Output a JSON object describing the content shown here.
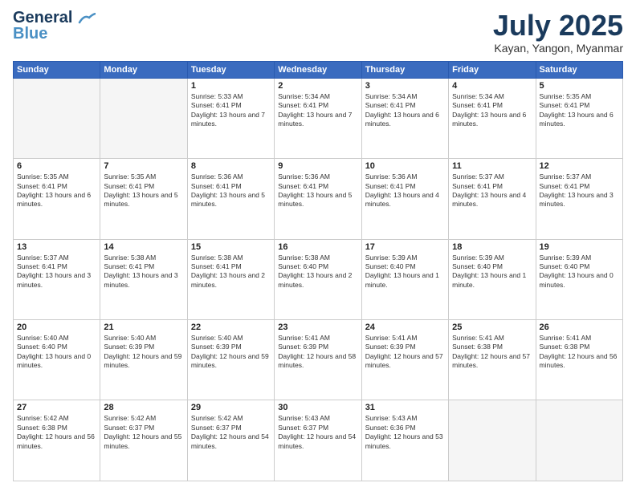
{
  "logo": {
    "line1": "General",
    "line2": "Blue"
  },
  "header": {
    "month": "July 2025",
    "location": "Kayan, Yangon, Myanmar"
  },
  "weekdays": [
    "Sunday",
    "Monday",
    "Tuesday",
    "Wednesday",
    "Thursday",
    "Friday",
    "Saturday"
  ],
  "weeks": [
    [
      {
        "day": "",
        "info": ""
      },
      {
        "day": "",
        "info": ""
      },
      {
        "day": "1",
        "info": "Sunrise: 5:33 AM\nSunset: 6:41 PM\nDaylight: 13 hours and 7 minutes."
      },
      {
        "day": "2",
        "info": "Sunrise: 5:34 AM\nSunset: 6:41 PM\nDaylight: 13 hours and 7 minutes."
      },
      {
        "day": "3",
        "info": "Sunrise: 5:34 AM\nSunset: 6:41 PM\nDaylight: 13 hours and 6 minutes."
      },
      {
        "day": "4",
        "info": "Sunrise: 5:34 AM\nSunset: 6:41 PM\nDaylight: 13 hours and 6 minutes."
      },
      {
        "day": "5",
        "info": "Sunrise: 5:35 AM\nSunset: 6:41 PM\nDaylight: 13 hours and 6 minutes."
      }
    ],
    [
      {
        "day": "6",
        "info": "Sunrise: 5:35 AM\nSunset: 6:41 PM\nDaylight: 13 hours and 6 minutes."
      },
      {
        "day": "7",
        "info": "Sunrise: 5:35 AM\nSunset: 6:41 PM\nDaylight: 13 hours and 5 minutes."
      },
      {
        "day": "8",
        "info": "Sunrise: 5:36 AM\nSunset: 6:41 PM\nDaylight: 13 hours and 5 minutes."
      },
      {
        "day": "9",
        "info": "Sunrise: 5:36 AM\nSunset: 6:41 PM\nDaylight: 13 hours and 5 minutes."
      },
      {
        "day": "10",
        "info": "Sunrise: 5:36 AM\nSunset: 6:41 PM\nDaylight: 13 hours and 4 minutes."
      },
      {
        "day": "11",
        "info": "Sunrise: 5:37 AM\nSunset: 6:41 PM\nDaylight: 13 hours and 4 minutes."
      },
      {
        "day": "12",
        "info": "Sunrise: 5:37 AM\nSunset: 6:41 PM\nDaylight: 13 hours and 3 minutes."
      }
    ],
    [
      {
        "day": "13",
        "info": "Sunrise: 5:37 AM\nSunset: 6:41 PM\nDaylight: 13 hours and 3 minutes."
      },
      {
        "day": "14",
        "info": "Sunrise: 5:38 AM\nSunset: 6:41 PM\nDaylight: 13 hours and 3 minutes."
      },
      {
        "day": "15",
        "info": "Sunrise: 5:38 AM\nSunset: 6:41 PM\nDaylight: 13 hours and 2 minutes."
      },
      {
        "day": "16",
        "info": "Sunrise: 5:38 AM\nSunset: 6:40 PM\nDaylight: 13 hours and 2 minutes."
      },
      {
        "day": "17",
        "info": "Sunrise: 5:39 AM\nSunset: 6:40 PM\nDaylight: 13 hours and 1 minute."
      },
      {
        "day": "18",
        "info": "Sunrise: 5:39 AM\nSunset: 6:40 PM\nDaylight: 13 hours and 1 minute."
      },
      {
        "day": "19",
        "info": "Sunrise: 5:39 AM\nSunset: 6:40 PM\nDaylight: 13 hours and 0 minutes."
      }
    ],
    [
      {
        "day": "20",
        "info": "Sunrise: 5:40 AM\nSunset: 6:40 PM\nDaylight: 13 hours and 0 minutes."
      },
      {
        "day": "21",
        "info": "Sunrise: 5:40 AM\nSunset: 6:39 PM\nDaylight: 12 hours and 59 minutes."
      },
      {
        "day": "22",
        "info": "Sunrise: 5:40 AM\nSunset: 6:39 PM\nDaylight: 12 hours and 59 minutes."
      },
      {
        "day": "23",
        "info": "Sunrise: 5:41 AM\nSunset: 6:39 PM\nDaylight: 12 hours and 58 minutes."
      },
      {
        "day": "24",
        "info": "Sunrise: 5:41 AM\nSunset: 6:39 PM\nDaylight: 12 hours and 57 minutes."
      },
      {
        "day": "25",
        "info": "Sunrise: 5:41 AM\nSunset: 6:38 PM\nDaylight: 12 hours and 57 minutes."
      },
      {
        "day": "26",
        "info": "Sunrise: 5:41 AM\nSunset: 6:38 PM\nDaylight: 12 hours and 56 minutes."
      }
    ],
    [
      {
        "day": "27",
        "info": "Sunrise: 5:42 AM\nSunset: 6:38 PM\nDaylight: 12 hours and 56 minutes."
      },
      {
        "day": "28",
        "info": "Sunrise: 5:42 AM\nSunset: 6:37 PM\nDaylight: 12 hours and 55 minutes."
      },
      {
        "day": "29",
        "info": "Sunrise: 5:42 AM\nSunset: 6:37 PM\nDaylight: 12 hours and 54 minutes."
      },
      {
        "day": "30",
        "info": "Sunrise: 5:43 AM\nSunset: 6:37 PM\nDaylight: 12 hours and 54 minutes."
      },
      {
        "day": "31",
        "info": "Sunrise: 5:43 AM\nSunset: 6:36 PM\nDaylight: 12 hours and 53 minutes."
      },
      {
        "day": "",
        "info": ""
      },
      {
        "day": "",
        "info": ""
      }
    ]
  ]
}
